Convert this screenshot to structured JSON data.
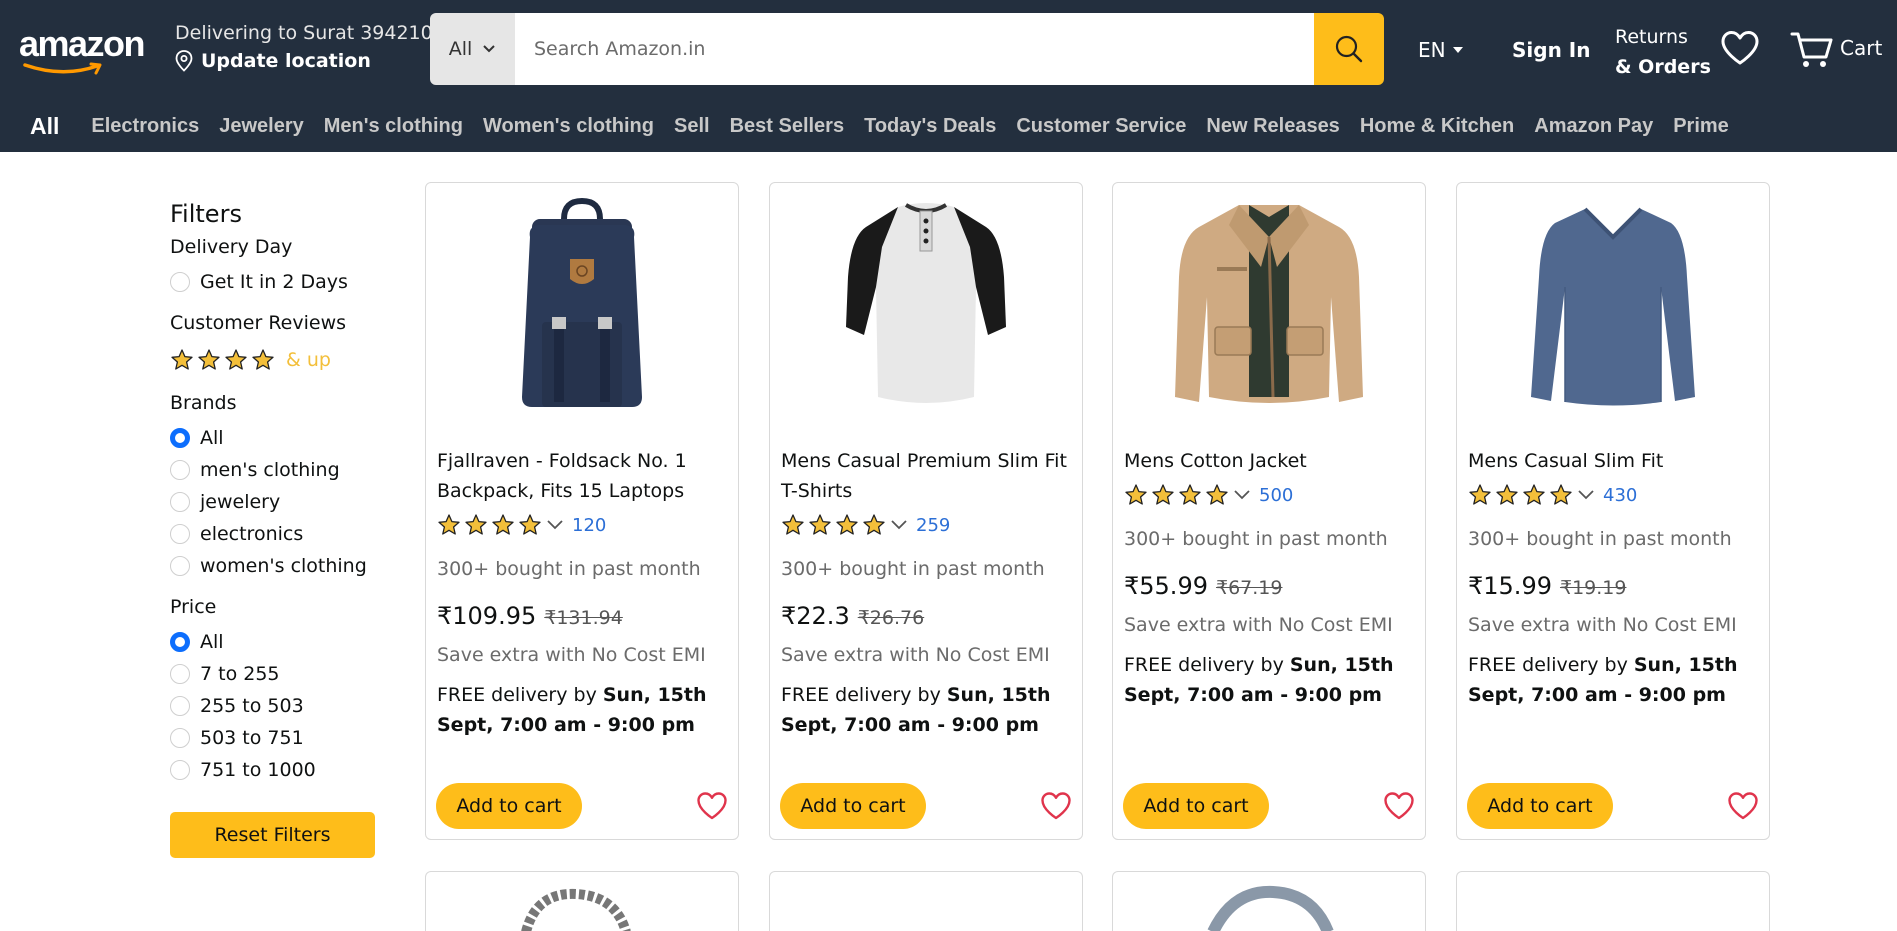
{
  "header": {
    "logo_text": "amazon",
    "delivering": "Delivering to Surat 394210",
    "update_location": "Update location",
    "search_category": "All",
    "search_placeholder": "Search Amazon.in",
    "lang": "EN",
    "sign_in": "Sign In",
    "returns_line1": "Returns",
    "returns_line2": "& Orders",
    "cart_label": "Cart"
  },
  "nav": {
    "all": "All",
    "items": [
      "Electronics",
      "Jewelery",
      "Men's clothing",
      "Women's clothing",
      "Sell",
      "Best Sellers",
      "Today's Deals",
      "Customer Service",
      "New Releases",
      "Home & Kitchen",
      "Amazon Pay",
      "Prime"
    ]
  },
  "filters": {
    "title": "Filters",
    "delivery_day": "Delivery Day",
    "delivery_option": "Get It in 2 Days",
    "customer_reviews": "Customer Reviews",
    "reviews_up": "& up",
    "brands": "Brands",
    "brand_options": [
      "All",
      "men's clothing",
      "jewelery",
      "electronics",
      "women's clothing"
    ],
    "price": "Price",
    "price_options": [
      "All",
      "7 to 255",
      "255 to 503",
      "503 to 751",
      "751 to 1000"
    ],
    "reset": "Reset Filters"
  },
  "products": [
    {
      "title": "Fjallraven - Foldsack No. 1 Backpack, Fits 15 Laptops",
      "stars": 4,
      "rating_count": "120",
      "bought": "300+ bought in past month",
      "price": "₹109.95",
      "old_price": "₹131.94",
      "emi": "Save extra with No Cost EMI",
      "delivery_prefix": "FREE delivery by ",
      "delivery_date": "Sun, 15th Sept, 7:00 am - 9:00 pm",
      "add_to_cart": "Add to cart",
      "image": "backpack"
    },
    {
      "title": "Mens Casual Premium Slim Fit T-Shirts",
      "stars": 4,
      "rating_count": "259",
      "bought": "300+ bought in past month",
      "price": "₹22.3",
      "old_price": "₹26.76",
      "emi": "Save extra with No Cost EMI",
      "delivery_prefix": "FREE delivery by ",
      "delivery_date": "Sun, 15th Sept, 7:00 am - 9:00 pm",
      "add_to_cart": "Add to cart",
      "image": "raglan-tshirt"
    },
    {
      "title": "Mens Cotton Jacket",
      "stars": 4,
      "rating_count": "500",
      "bought": "300+ bought in past month",
      "price": "₹55.99",
      "old_price": "₹67.19",
      "emi": "Save extra with No Cost EMI",
      "delivery_prefix": "FREE delivery by ",
      "delivery_date": "Sun, 15th Sept, 7:00 am - 9:00 pm",
      "add_to_cart": "Add to cart",
      "image": "jacket"
    },
    {
      "title": "Mens Casual Slim Fit",
      "stars": 4,
      "rating_count": "430",
      "bought": "300+ bought in past month",
      "price": "₹15.99",
      "old_price": "₹19.19",
      "emi": "Save extra with No Cost EMI",
      "delivery_prefix": "FREE delivery by ",
      "delivery_date": "Sun, 15th Sept, 7:00 am - 9:00 pm",
      "add_to_cart": "Add to cart",
      "image": "longsleeve"
    }
  ],
  "colors": {
    "header_bg": "#232f3e",
    "accent_yellow": "#febd1a",
    "star": "#f3bf3a",
    "link_blue": "#2c6fd6",
    "heart_red": "#e0344c",
    "radio_blue": "#0d6efd"
  }
}
